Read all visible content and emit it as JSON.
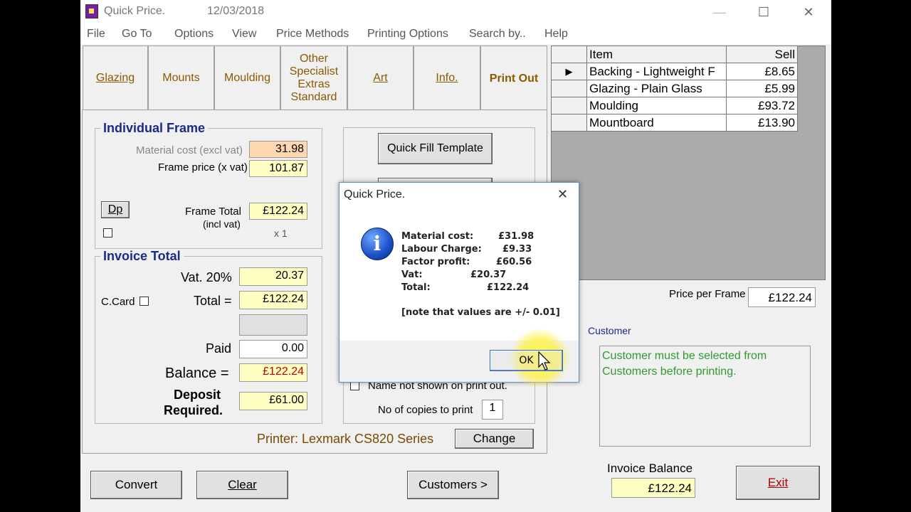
{
  "window": {
    "title": "Quick Price.",
    "date": "12/03/2018",
    "controls": {
      "minimize": "—",
      "maximize": "☐",
      "close": "✕"
    }
  },
  "menu": [
    "File",
    "Go To",
    "Options",
    "View",
    "Price Methods",
    "Printing Options",
    "Search by..",
    "Help"
  ],
  "tabs": [
    {
      "label": "Glazing"
    },
    {
      "label": "Mounts"
    },
    {
      "label": "Moulding"
    },
    {
      "label": "Other\nSpecialist\nExtras\nStandard"
    },
    {
      "label": "Art"
    },
    {
      "label": "Info."
    },
    {
      "label": "Print Out",
      "active": true
    }
  ],
  "individual_frame": {
    "title": "Individual Frame",
    "material_cost_label": "Material cost (excl vat)",
    "material_cost": "31.98",
    "frame_price_label": "Frame price (x vat)",
    "frame_price": "101.87",
    "dp_label": "Dp",
    "frame_total_label": "Frame Total",
    "frame_total_sub": "(incl vat)",
    "frame_total": "£122.24",
    "multiplier": "x 1"
  },
  "invoice_total": {
    "title": "Invoice Total",
    "vat_label": "Vat. 20%",
    "vat": "20.37",
    "ccard_label": "C.Card",
    "total_label": "Total =",
    "total": "£122.24",
    "paid_label": "Paid",
    "paid": "0.00",
    "balance_label": "Balance =",
    "balance": "£122.24",
    "deposit_label_1": "Deposit",
    "deposit_label_2": "Required.",
    "deposit": "£61.00"
  },
  "print_panel": {
    "quick_fill_label": "Quick Fill Template",
    "name_not_shown_label": "Name not shown on print out.",
    "copies_label": "No of copies to print",
    "copies": "1",
    "printer_label": "Printer: Lexmark CS820 Series",
    "change_label": "Change"
  },
  "grid": {
    "headers": [
      "Item",
      "Sell"
    ],
    "rows": [
      {
        "item": "Backing - Lightweight F",
        "sell": "£8.65",
        "selected": true
      },
      {
        "item": "Glazing - Plain Glass",
        "sell": "£5.99"
      },
      {
        "item": "Moulding",
        "sell": "£93.72"
      },
      {
        "item": "Mountboard",
        "sell": "£13.90"
      }
    ]
  },
  "price_per_frame_label": "Price per Frame",
  "price_per_frame": "£122.24",
  "customer": {
    "label": "Customer",
    "message": "Customer must be selected from Customers before printing."
  },
  "invoice_balance_label": "Invoice Balance",
  "invoice_balance": "£122.24",
  "buttons": {
    "convert": "Convert",
    "clear": "Clear",
    "customers": "Customers >",
    "exit": "Exit"
  },
  "dialog": {
    "title": "Quick Price.",
    "close": "✕",
    "lines": [
      {
        "label": "Material cost:",
        "value": "£31.98"
      },
      {
        "label": "Labour Charge:",
        "value": "£9.33"
      },
      {
        "label": "Factor profit:",
        "value": "£60.56"
      },
      {
        "label": "Vat:",
        "value": "£20.37"
      },
      {
        "label": "Total:",
        "value": "£122.24"
      }
    ],
    "note": "[note that values are +/- 0.01]",
    "ok": "OK"
  },
  "colors": {
    "accent_tab_text": "#8a5a00",
    "group_title": "#1a2a8a",
    "field_orange": "#ffd7b0",
    "field_yellow": "#ffffc4",
    "balance_red": "#c00000",
    "customer_msg": "#2e9b2e",
    "printer_text": "#7a4a00"
  }
}
